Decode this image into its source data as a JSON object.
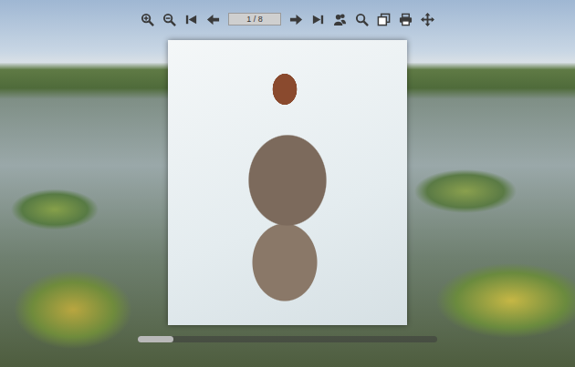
{
  "viewer": {
    "page_indicator": "1 / 8"
  },
  "scrollbar": {
    "level": 0.12
  }
}
